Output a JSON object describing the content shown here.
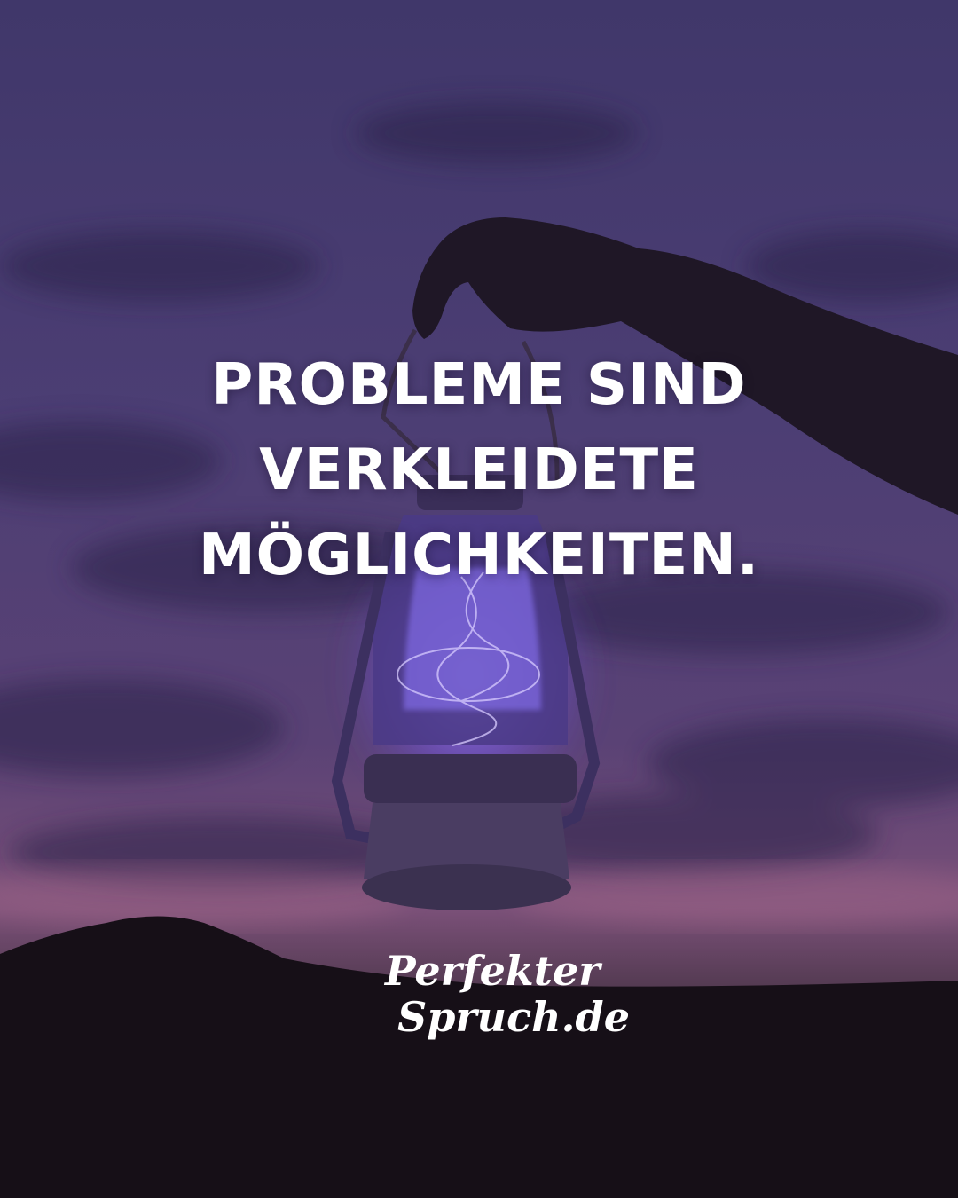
{
  "quote": {
    "lines": [
      "PROBLEME SIND",
      "VERKLEIDETE",
      "MÖGLICHKEITEN."
    ]
  },
  "logo": {
    "line1": "Perfekter",
    "line2": "Spruch.de"
  },
  "colors": {
    "sky_top": "#463a6a",
    "sky_mid": "#4f3f73",
    "sky_dusk": "#7a4f7a",
    "ground": "#150f17",
    "lantern_glow": "#8a6cff",
    "text": "#ffffff"
  }
}
